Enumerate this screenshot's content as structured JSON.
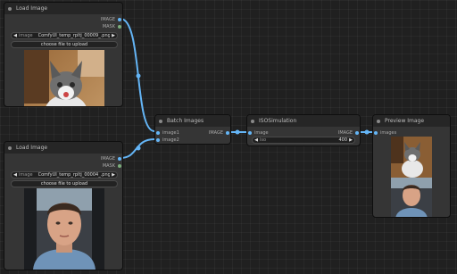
{
  "nodes": {
    "load_image_1": {
      "title": "Load Image",
      "outputs": [
        "IMAGE",
        "MASK"
      ],
      "widget_name": "image",
      "widget_value": "ComfyUI_temp_rpltj_00009_.png",
      "upload_label": "choose file to upload"
    },
    "load_image_2": {
      "title": "Load Image",
      "outputs": [
        "IMAGE",
        "MASK"
      ],
      "widget_name": "image",
      "widget_value": "ComfyUI_temp_rpltj_00004_.png",
      "upload_label": "choose file to upload"
    },
    "batch_images": {
      "title": "Batch Images",
      "inputs": [
        "image1",
        "image2"
      ],
      "outputs": [
        "IMAGE"
      ]
    },
    "iso_simulation": {
      "title": "ISOSimulation",
      "inputs": [
        "image"
      ],
      "outputs": [
        "IMAGE"
      ],
      "widget_name": "iso",
      "widget_value": "400"
    },
    "preview_image": {
      "title": "Preview Image",
      "inputs": [
        "images"
      ]
    }
  },
  "colors": {
    "canvas": "#202020",
    "node_body": "#353535",
    "node_title": "#262626",
    "image_link": "#64b5f6",
    "mask_socket": "#7cae7c"
  }
}
